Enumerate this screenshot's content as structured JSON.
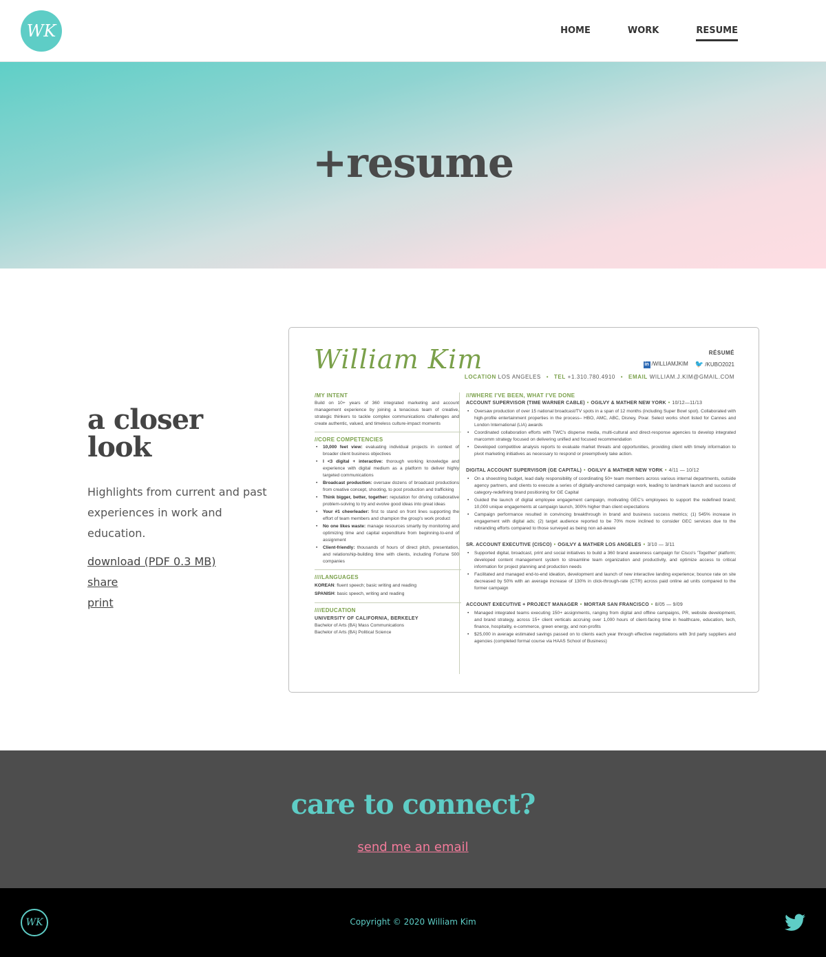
{
  "header": {
    "logo_text": "WK",
    "nav": [
      {
        "label": "HOME",
        "active": false
      },
      {
        "label": "WORK",
        "active": false
      },
      {
        "label": "RESUME",
        "active": true
      }
    ]
  },
  "hero": {
    "title": "+resume"
  },
  "intro": {
    "heading": "a closer look",
    "text": "Highlights from current and past experiences in work and education.",
    "links": {
      "download": "download (PDF 0.3 MB)",
      "share": "share",
      "print": "print"
    }
  },
  "resume": {
    "name": "William Kim",
    "label": "RÉSUMÉ",
    "linkedin": "/WILLIAMJKIM",
    "twitter": "/KUBO2021",
    "contact": {
      "location_label": "LOCATION",
      "location": "LOS ANGELES",
      "tel_label": "TEL",
      "tel": "+1.310.780.4910",
      "email_label": "EMAIL",
      "email": "WILLIAM.J.KIM@GMAIL.COM"
    },
    "intent_title": "/MY INTENT",
    "intent_text": "Build on 10+ years of 360 integrated marketing and account management experience by joining a tenacious team of creative, strategic thinkers to tackle complex communications challenges and create authentic, valued, and timeless culture-impact moments",
    "core_title": "//CORE COMPETENCIES",
    "core": [
      {
        "bold": "10,000 feet view:",
        "text": " evaluating individual projects in context of broader client business objectives"
      },
      {
        "bold": "I <3 digital + interactive:",
        "text": " thorough working knowledge and experience with digital medium as a platform to deliver highly targeted communications"
      },
      {
        "bold": "Broadcast production:",
        "text": " oversaw dozens of broadcast productions from creative concept, shooting, to post production and trafficking"
      },
      {
        "bold": "Think bigger, better, together:",
        "text": " reputation for driving collaborative problem-solving to try and evolve good ideas into great ideas"
      },
      {
        "bold": "Your #1 cheerleader:",
        "text": " first to stand on front lines supporting the effort of team members and champion the group's work product"
      },
      {
        "bold": "No one likes waste:",
        "text": " manage resources smartly by monitoring and optimizing time and capital expenditure from beginning-to-end of assignment"
      },
      {
        "bold": "Client-friendly:",
        "text": " thousands of hours of direct pitch, presentation, and relationship-building time with clients, including Fortune 500 companies"
      }
    ],
    "languages_title": "////LANGUAGES",
    "languages": [
      {
        "bold": "KOREAN",
        "text": ": fluent speech; basic writing and reading"
      },
      {
        "bold": "SPANISH",
        "text": ": basic speech, writing and reading"
      }
    ],
    "education_title": "////EDUCATION",
    "school": "UNIVERSITY OF CALIFORNIA, BERKELEY",
    "degrees": [
      "Bachelor of Arts (BA) Mass Communications",
      "Bachelor of Arts (BA) Political Science"
    ],
    "experience_title": "///WHERE I'VE BEEN, WHAT I'VE DONE",
    "jobs": [
      {
        "title": "ACCOUNT SUPERVISOR (TIME WARNER CABLE)",
        "company": "OGILVY & MATHER  NEW YORK",
        "dates": "10/12—11/13",
        "bullets": [
          "Oversaw production of over 15 national broadcast/TV spots in a span of 12 months (including Super Bowl spot). Collaborated with high-profile entertainment properties in the process– HBO, AMC, ABC, Disney, Pixar. Select works short listed for Cannes and London International (LIA) awards",
          "Coordinated collaboration efforts with TWC's disperse media, multi-cultural and direct-response agencies to develop integrated marcomm strategy focused on delivering unified and focused recommendation",
          "Developed competitive analysis reports to evaluate market threats and opportunities, providing client with timely information to pivot marketing initiatives as necessary to respond or preemptively take action."
        ]
      },
      {
        "title": "DIGITAL ACCOUNT SUPERVISOR (GE CAPITAL)",
        "company": "OGILVY & MATHER NEW YORK",
        "dates": "4/11 — 10/12",
        "bullets": [
          "On a shoestring budget, lead daily responsibility of coordinating 50+ team members across various internal departments, outside agency partners, and clients to execute a series of digitally-anchored campaign work, leading to landmark launch and success of category-redefining brand positioning for GE Capital",
          "Guided the launch of digital employee engagement campaign, motivating GEC's employees to support the redefined brand; 10,000 unique engagements at campaign launch, 300% higher than client expectations",
          "Campaign performance resulted in convincing breakthrough in brand and business success metrics; (1) 545% increase in engagement with digital ads; (2) target audience reported to be 70% more inclined to consider GEC services due to the rebranding efforts compared to those surveyed as being non ad-aware"
        ]
      },
      {
        "title": "SR. ACCOUNT EXECUTIVE (CISCO)",
        "company": "OGILVY & MATHER LOS ANGELES",
        "dates": "3/10 — 3/11",
        "bullets": [
          "Supported digital, broadcast, print and social initiatives to build a 360 brand awareness campaign for Cisco's 'Together' platform; developed content management system to streamline team organization and productivity, and optimize access to critical information for project planning and production needs",
          "Facilitated and managed end-to-end ideation, development and launch of new interactive landing experience; bounce rate on site decreased by 50% with an average increase of 130% in click-through-rate (CTR) across paid online ad units compared to the former campaign"
        ]
      },
      {
        "title": "ACCOUNT EXECUTIVE + PROJECT MANAGER",
        "company": "MORTAR SAN FRANCISCO",
        "dates": "8/05 — 9/09",
        "bullets": [
          "Managed integrated teams executing 150+ assignments, ranging from digital and offline campaigns, PR, website development, and brand strategy, across 15+ client verticals accruing over 1,000 hours of client-facing time in healthcare, education, tech, finance, hospitality, e-commerce, green energy, and non-profits",
          "$25,000 in average estimated savings passed on to clients each year through effective negotiations with 3rd party suppliers and agencies (completed formal course via HAAS School of Business)"
        ]
      }
    ]
  },
  "connect": {
    "heading": "care to connect?",
    "link": "send me an email"
  },
  "footer": {
    "logo_text": "WK",
    "copyright": "Copyright © 2020 William Kim"
  },
  "colors": {
    "accent": "#5ecdc6",
    "link_pink": "#f47b9b",
    "resume_green": "#7aa04a",
    "dark_band": "#4d4d4d"
  }
}
